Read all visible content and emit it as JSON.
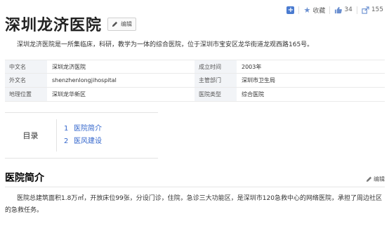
{
  "actions": {
    "favorite_label": "收藏",
    "like_count": "34",
    "share_count": "155"
  },
  "title": "深圳龙济医院",
  "edit_label": "编辑",
  "summary": "深圳龙济医院是一所集临床，科研，教学为一体的综合医院，位于深圳市宝安区龙华街道龙观西路165号。",
  "info": {
    "rows": [
      {
        "k1": "中文名",
        "v1": "深圳龙济医院",
        "k2": "成立时间",
        "v2": "2003年"
      },
      {
        "k1": "外文名",
        "v1": "shenzhenlongjihospital",
        "k2": "主管部门",
        "v2": "深圳市卫生局"
      },
      {
        "k1": "地理位置",
        "v1": "深圳龙华新区",
        "k2": "医院类型",
        "v2": "综合医院"
      }
    ]
  },
  "catalog": {
    "label": "目录",
    "items": [
      {
        "num": "1",
        "text": "医院简介"
      },
      {
        "num": "2",
        "text": "医风建设"
      }
    ]
  },
  "section": {
    "title": "医院简介",
    "edit_label": "编辑",
    "body": "医院总建筑面积1.8万㎡，开放床位99张，分设门诊，住院，急诊三大功能区，是深圳市120急救中心的网络医院，承担了周边社区的急救任务。"
  }
}
